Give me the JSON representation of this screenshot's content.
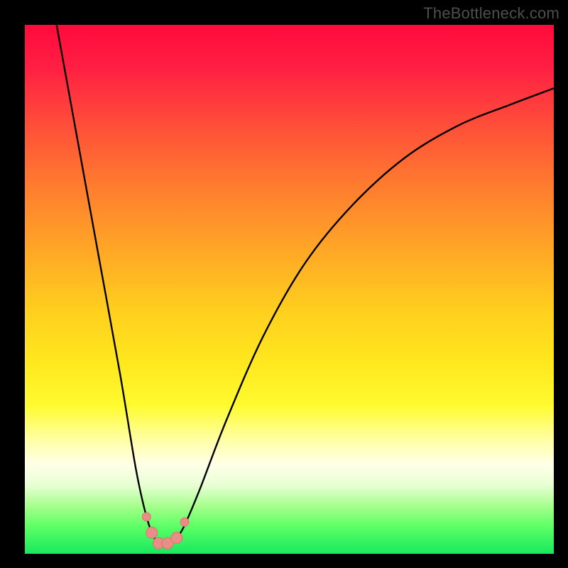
{
  "watermark": "TheBottleneck.com",
  "colors": {
    "frame": "#000000",
    "curve": "#000000",
    "marker_fill": "#e98d86",
    "marker_stroke": "#d8766e"
  },
  "chart_data": {
    "type": "line",
    "title": "",
    "xlabel": "",
    "ylabel": "",
    "xlim": [
      0,
      100
    ],
    "ylim": [
      0,
      100
    ],
    "note": "V-shaped bottleneck curve; y≈100 is worst (top, red), y≈0 is best (bottom, green). Minimum of curve sits near x≈26, y≈2.",
    "series": [
      {
        "name": "bottleneck-curve",
        "x": [
          6,
          10,
          14,
          18,
          21,
          23,
          24.5,
          25.5,
          27,
          28.5,
          30,
          33,
          38,
          45,
          53,
          62,
          72,
          82,
          92,
          100
        ],
        "y": [
          100,
          78,
          56,
          34,
          16,
          7,
          3,
          2,
          2,
          3,
          5,
          12,
          25,
          41,
          55,
          66,
          75,
          81,
          85,
          88
        ]
      }
    ],
    "markers": {
      "name": "optimal-cluster",
      "points": [
        {
          "x": 23.0,
          "y": 7
        },
        {
          "x": 24.0,
          "y": 4
        },
        {
          "x": 25.3,
          "y": 2
        },
        {
          "x": 27.0,
          "y": 2
        },
        {
          "x": 28.7,
          "y": 3
        },
        {
          "x": 30.2,
          "y": 6
        }
      ]
    }
  }
}
